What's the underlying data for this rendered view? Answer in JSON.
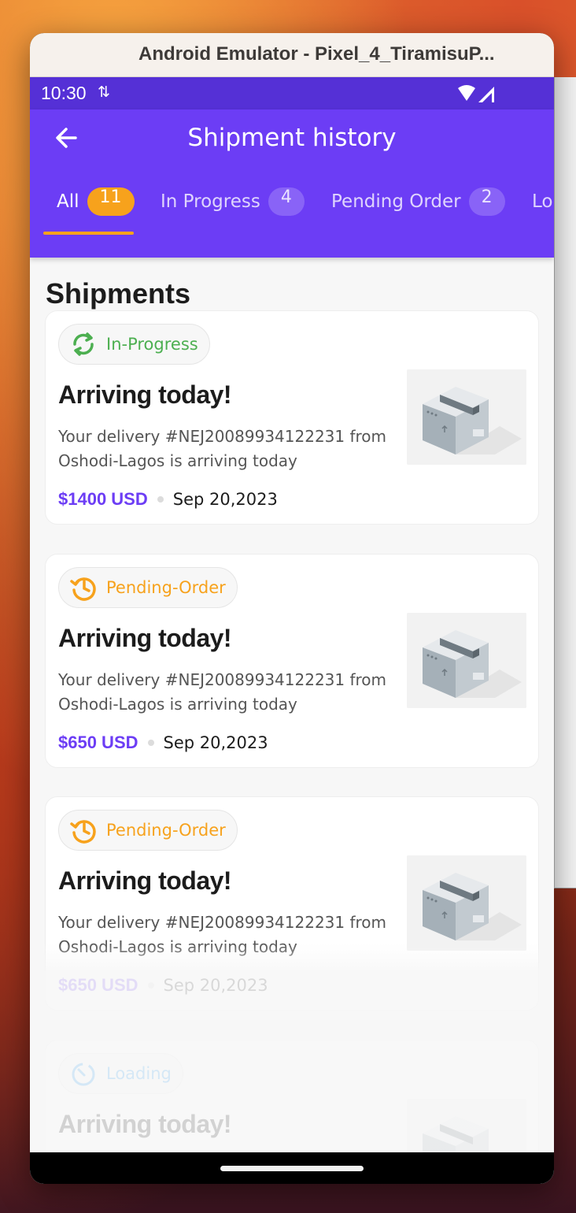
{
  "window": {
    "title": "Android Emulator - Pixel_4_TiramisuP..."
  },
  "status_bar": {
    "time": "10:30"
  },
  "app_bar": {
    "title": "Shipment history"
  },
  "tabs": [
    {
      "label": "All",
      "count": "11"
    },
    {
      "label": "In Progress",
      "count": "4"
    },
    {
      "label": "Pending Order",
      "count": "2"
    },
    {
      "label": "Lo",
      "count": ""
    }
  ],
  "section_title": "Shipments",
  "shipments": [
    {
      "status": "In-Progress",
      "status_icon": "sync-icon",
      "status_color": "#4caf50",
      "heading": "Arriving today!",
      "description": "Your delivery #NEJ20089934122231 from Oshodi-Lagos is arriving today",
      "price": "$1400 USD",
      "date": "Sep 20,2023"
    },
    {
      "status": "Pending-Order",
      "status_icon": "history-icon",
      "status_color": "#f7a21c",
      "heading": "Arriving today!",
      "description": "Your delivery #NEJ20089934122231 from Oshodi-Lagos is arriving today",
      "price": "$650 USD",
      "date": "Sep 20,2023"
    },
    {
      "status": "Pending-Order",
      "status_icon": "history-icon",
      "status_color": "#f7a21c",
      "heading": "Arriving today!",
      "description": "Your delivery #NEJ20089934122231 from Oshodi-Lagos is arriving today",
      "price": "$650 USD",
      "date": "Sep 20,2023"
    },
    {
      "status": "Loading",
      "status_icon": "timer-icon",
      "status_color": "#2196f3",
      "heading": "Arriving today!",
      "description": "",
      "price": "",
      "date": ""
    }
  ],
  "colors": {
    "primary": "#6c3df5",
    "status_bar": "#5530d6",
    "accent": "#f7a21c"
  }
}
